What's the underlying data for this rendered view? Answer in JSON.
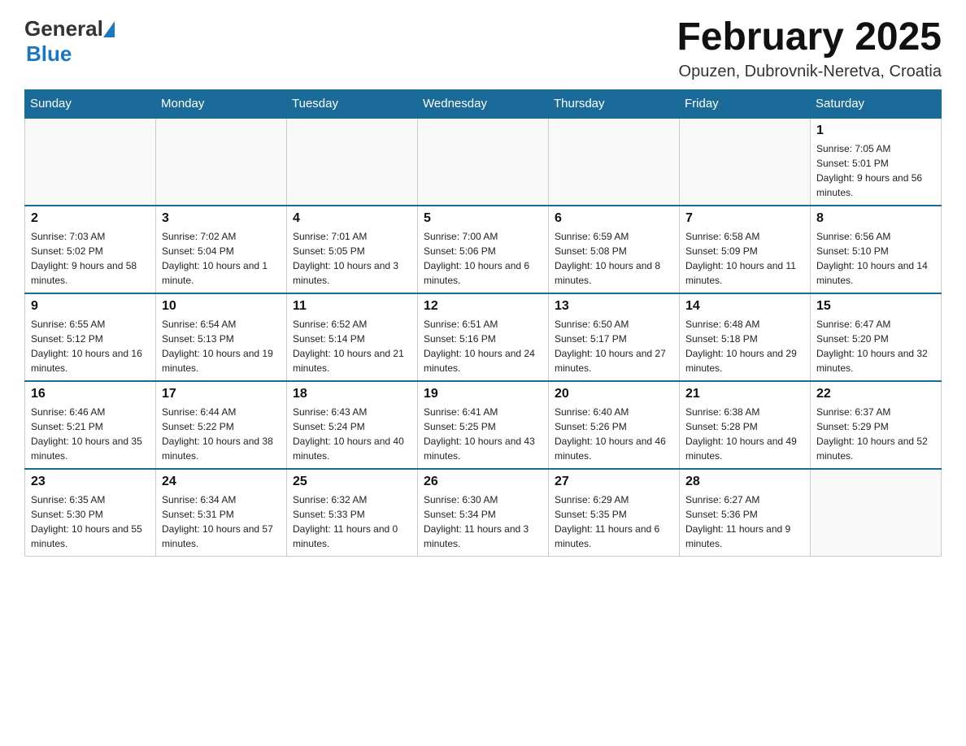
{
  "logo": {
    "general": "General",
    "blue": "Blue"
  },
  "title": "February 2025",
  "location": "Opuzen, Dubrovnik-Neretva, Croatia",
  "days_of_week": [
    "Sunday",
    "Monday",
    "Tuesday",
    "Wednesday",
    "Thursday",
    "Friday",
    "Saturday"
  ],
  "weeks": [
    [
      {
        "day": "",
        "info": ""
      },
      {
        "day": "",
        "info": ""
      },
      {
        "day": "",
        "info": ""
      },
      {
        "day": "",
        "info": ""
      },
      {
        "day": "",
        "info": ""
      },
      {
        "day": "",
        "info": ""
      },
      {
        "day": "1",
        "info": "Sunrise: 7:05 AM\nSunset: 5:01 PM\nDaylight: 9 hours and 56 minutes."
      }
    ],
    [
      {
        "day": "2",
        "info": "Sunrise: 7:03 AM\nSunset: 5:02 PM\nDaylight: 9 hours and 58 minutes."
      },
      {
        "day": "3",
        "info": "Sunrise: 7:02 AM\nSunset: 5:04 PM\nDaylight: 10 hours and 1 minute."
      },
      {
        "day": "4",
        "info": "Sunrise: 7:01 AM\nSunset: 5:05 PM\nDaylight: 10 hours and 3 minutes."
      },
      {
        "day": "5",
        "info": "Sunrise: 7:00 AM\nSunset: 5:06 PM\nDaylight: 10 hours and 6 minutes."
      },
      {
        "day": "6",
        "info": "Sunrise: 6:59 AM\nSunset: 5:08 PM\nDaylight: 10 hours and 8 minutes."
      },
      {
        "day": "7",
        "info": "Sunrise: 6:58 AM\nSunset: 5:09 PM\nDaylight: 10 hours and 11 minutes."
      },
      {
        "day": "8",
        "info": "Sunrise: 6:56 AM\nSunset: 5:10 PM\nDaylight: 10 hours and 14 minutes."
      }
    ],
    [
      {
        "day": "9",
        "info": "Sunrise: 6:55 AM\nSunset: 5:12 PM\nDaylight: 10 hours and 16 minutes."
      },
      {
        "day": "10",
        "info": "Sunrise: 6:54 AM\nSunset: 5:13 PM\nDaylight: 10 hours and 19 minutes."
      },
      {
        "day": "11",
        "info": "Sunrise: 6:52 AM\nSunset: 5:14 PM\nDaylight: 10 hours and 21 minutes."
      },
      {
        "day": "12",
        "info": "Sunrise: 6:51 AM\nSunset: 5:16 PM\nDaylight: 10 hours and 24 minutes."
      },
      {
        "day": "13",
        "info": "Sunrise: 6:50 AM\nSunset: 5:17 PM\nDaylight: 10 hours and 27 minutes."
      },
      {
        "day": "14",
        "info": "Sunrise: 6:48 AM\nSunset: 5:18 PM\nDaylight: 10 hours and 29 minutes."
      },
      {
        "day": "15",
        "info": "Sunrise: 6:47 AM\nSunset: 5:20 PM\nDaylight: 10 hours and 32 minutes."
      }
    ],
    [
      {
        "day": "16",
        "info": "Sunrise: 6:46 AM\nSunset: 5:21 PM\nDaylight: 10 hours and 35 minutes."
      },
      {
        "day": "17",
        "info": "Sunrise: 6:44 AM\nSunset: 5:22 PM\nDaylight: 10 hours and 38 minutes."
      },
      {
        "day": "18",
        "info": "Sunrise: 6:43 AM\nSunset: 5:24 PM\nDaylight: 10 hours and 40 minutes."
      },
      {
        "day": "19",
        "info": "Sunrise: 6:41 AM\nSunset: 5:25 PM\nDaylight: 10 hours and 43 minutes."
      },
      {
        "day": "20",
        "info": "Sunrise: 6:40 AM\nSunset: 5:26 PM\nDaylight: 10 hours and 46 minutes."
      },
      {
        "day": "21",
        "info": "Sunrise: 6:38 AM\nSunset: 5:28 PM\nDaylight: 10 hours and 49 minutes."
      },
      {
        "day": "22",
        "info": "Sunrise: 6:37 AM\nSunset: 5:29 PM\nDaylight: 10 hours and 52 minutes."
      }
    ],
    [
      {
        "day": "23",
        "info": "Sunrise: 6:35 AM\nSunset: 5:30 PM\nDaylight: 10 hours and 55 minutes."
      },
      {
        "day": "24",
        "info": "Sunrise: 6:34 AM\nSunset: 5:31 PM\nDaylight: 10 hours and 57 minutes."
      },
      {
        "day": "25",
        "info": "Sunrise: 6:32 AM\nSunset: 5:33 PM\nDaylight: 11 hours and 0 minutes."
      },
      {
        "day": "26",
        "info": "Sunrise: 6:30 AM\nSunset: 5:34 PM\nDaylight: 11 hours and 3 minutes."
      },
      {
        "day": "27",
        "info": "Sunrise: 6:29 AM\nSunset: 5:35 PM\nDaylight: 11 hours and 6 minutes."
      },
      {
        "day": "28",
        "info": "Sunrise: 6:27 AM\nSunset: 5:36 PM\nDaylight: 11 hours and 9 minutes."
      },
      {
        "day": "",
        "info": ""
      }
    ]
  ]
}
